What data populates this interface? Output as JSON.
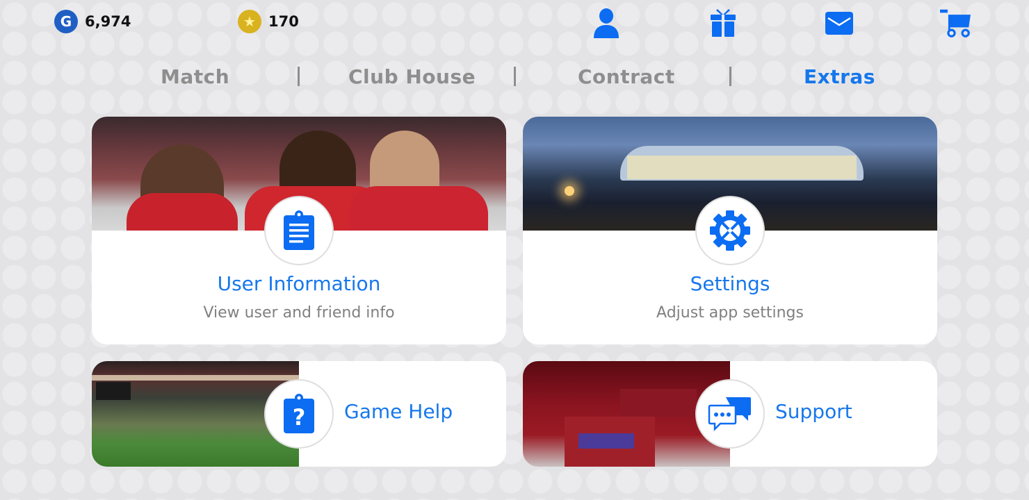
{
  "topbar": {
    "gp": {
      "icon": "gp-coin-icon",
      "letter": "G",
      "value": "6,974"
    },
    "coins": {
      "icon": "star-coin-icon",
      "glyph": "★",
      "value": "170"
    },
    "icons": [
      "user-icon",
      "gift-icon",
      "mail-icon",
      "cart-icon"
    ]
  },
  "tabs": [
    {
      "label": "Match",
      "active": false
    },
    {
      "label": "Club House",
      "active": false
    },
    {
      "label": "Contract",
      "active": false
    },
    {
      "label": "Extras",
      "active": true
    }
  ],
  "colors": {
    "accent": "#1677ec",
    "inactive_tab": "#8e8e8e",
    "background": "#e3e3e5",
    "gp_coin": "#1f5fc4",
    "star_coin": "#d9b21f"
  },
  "cards": {
    "user_info": {
      "title": "User Information",
      "subtitle": "View user and friend info",
      "icon": "clipboard-list-icon",
      "photo": "players-celebrating-photo"
    },
    "settings": {
      "title": "Settings",
      "subtitle": "Adjust app settings",
      "icon": "gear-icon",
      "photo": "stadium-night-photo"
    },
    "game_help": {
      "title": "Game Help",
      "icon": "clipboard-question-icon",
      "photo": "stadium-pitch-photo"
    },
    "support": {
      "title": "Support",
      "icon": "chat-bubbles-icon",
      "photo": "locker-room-photo"
    }
  }
}
